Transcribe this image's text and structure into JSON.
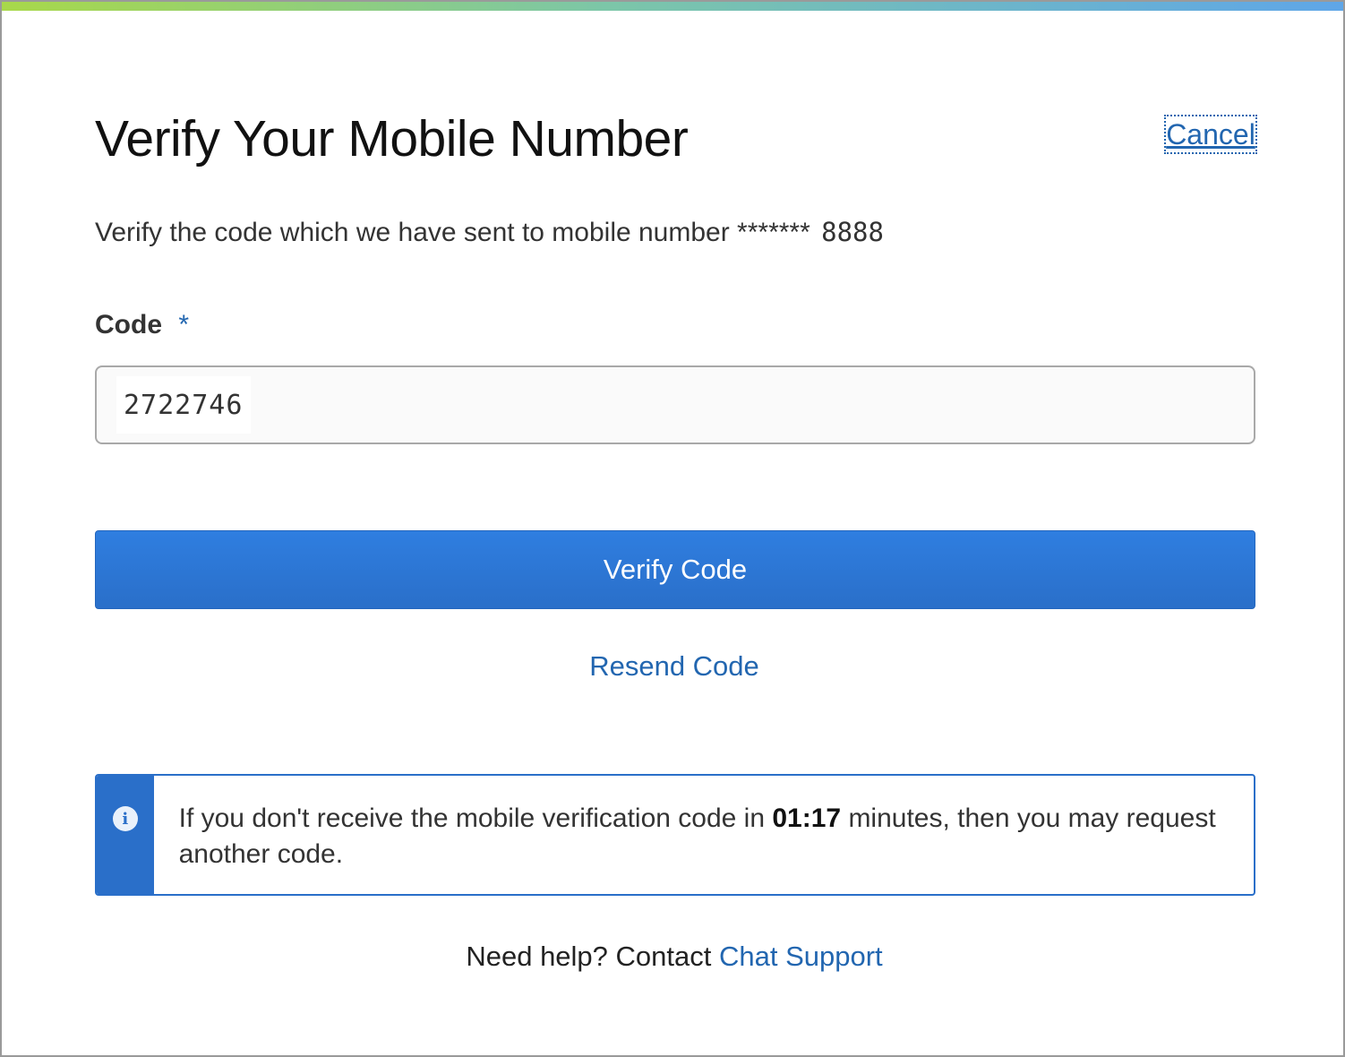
{
  "page": {
    "title": "Verify Your Mobile Number",
    "cancel_label": "Cancel"
  },
  "description": {
    "text": "Verify the code which we have sent to mobile number *******",
    "masked_suffix": "8888"
  },
  "form": {
    "code_label": "Code",
    "required_marker": "*",
    "code_value": "2722746"
  },
  "actions": {
    "verify_label": "Verify Code",
    "resend_label": "Resend Code"
  },
  "info": {
    "icon": "info-icon",
    "text_before": "If you don't receive the mobile verification code in ",
    "countdown": "01:17",
    "text_after": " minutes, then you may request another code."
  },
  "help": {
    "prefix": "Need help? Contact ",
    "link_label": "Chat Support"
  },
  "colors": {
    "accent": "#2a6fc9",
    "link": "#2266b0"
  }
}
